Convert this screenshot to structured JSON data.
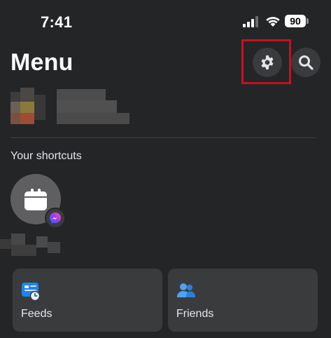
{
  "status_bar": {
    "time": "7:41",
    "battery": "90"
  },
  "header": {
    "title": "Menu",
    "settings_icon": "gear-icon",
    "search_icon": "search-icon"
  },
  "shortcuts": {
    "section_label": "Your shortcuts",
    "items": [
      {
        "icon": "calendar-icon",
        "badge_icon": "messenger-icon"
      }
    ]
  },
  "cards": [
    {
      "label": "Feeds",
      "icon": "feeds-icon"
    },
    {
      "label": "Friends",
      "icon": "friends-icon"
    }
  ],
  "colors": {
    "background": "#242527",
    "surface": "#3a3b3c",
    "highlight": "#c4121e"
  }
}
